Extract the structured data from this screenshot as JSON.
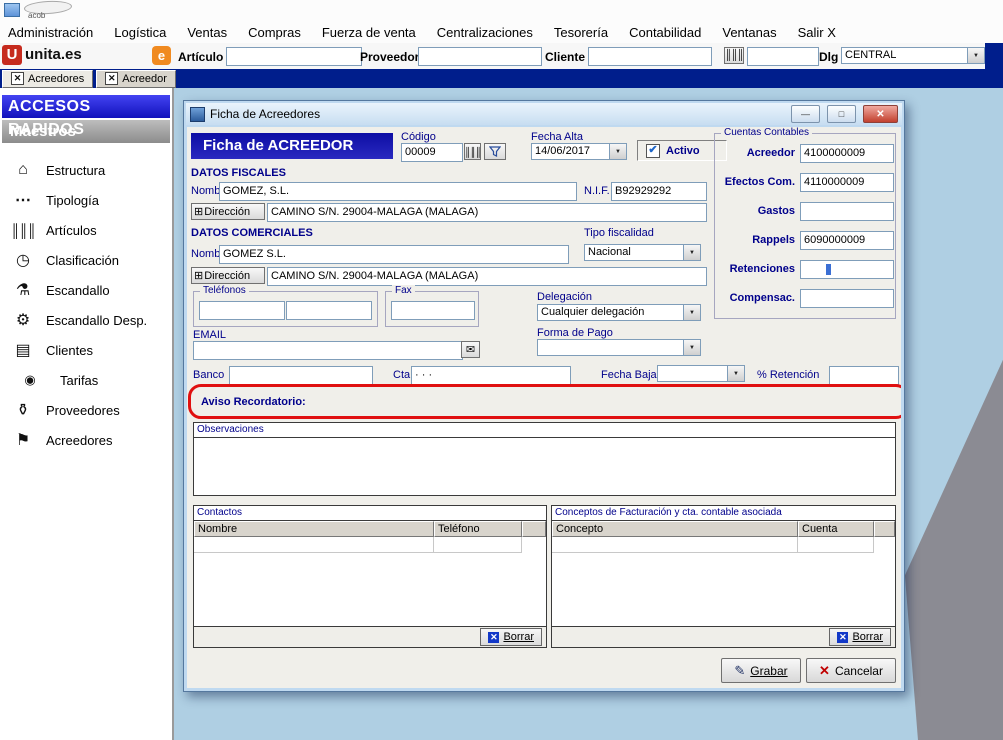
{
  "window": {
    "logo_text": "acob"
  },
  "menubar": {
    "items": [
      "Administración",
      "Logística",
      "Ventas",
      "Compras",
      "Fuerza de venta",
      "Centralizaciones",
      "Tesorería",
      "Contabilidad",
      "Ventanas",
      "Salir X"
    ]
  },
  "toolbar": {
    "brand_u": "U",
    "brand_name": "unita.es",
    "brand_e": "e",
    "articulo_label": "Artículo",
    "proveedor_label": "Proveedor",
    "cliente_label": "Cliente",
    "dlg_label": "Dlg",
    "dlg_value": "CENTRAL"
  },
  "tabs": [
    {
      "label": "Acreedores"
    },
    {
      "label": "Acreedor"
    }
  ],
  "sidebar": {
    "title": "ACCESOS RAPIDOS",
    "section": "Maestros",
    "items": [
      {
        "label": "Estructura",
        "icon": "⌂"
      },
      {
        "label": "Tipología",
        "icon": "⋯"
      },
      {
        "label": "Artículos",
        "icon": "║║║"
      },
      {
        "label": "Clasificación",
        "icon": "◷"
      },
      {
        "label": "Escandallo",
        "icon": "⚗"
      },
      {
        "label": "Escandallo Desp.",
        "icon": "⚙"
      },
      {
        "label": "Clientes",
        "icon": "▤"
      },
      {
        "label": "Tarifas",
        "icon": "◉"
      },
      {
        "label": "Proveedores",
        "icon": "⚱"
      },
      {
        "label": "Acreedores",
        "icon": "⚑"
      }
    ]
  },
  "dialog": {
    "title": "Ficha de Acreedores",
    "banner": "Ficha de ACREEDOR",
    "codigo": {
      "label": "Código",
      "value": "00009"
    },
    "fecha_alta": {
      "label": "Fecha Alta",
      "value": "14/06/2017"
    },
    "activo_label": "Activo",
    "cuentas": {
      "title": "Cuentas Contables",
      "rows": [
        {
          "label": "Acreedor",
          "value": "4100000009"
        },
        {
          "label": "Efectos Com.",
          "value": "4110000009"
        },
        {
          "label": "Gastos",
          "value": ""
        },
        {
          "label": "Rappels",
          "value": "6090000009"
        },
        {
          "label": "Retenciones",
          "value": ""
        },
        {
          "label": "Compensac.",
          "value": ""
        }
      ]
    },
    "fiscales": {
      "title": "DATOS FISCALES",
      "nombre_label": "Nombre",
      "nombre": "GOMEZ, S.L.",
      "nif_label": "N.I.F.",
      "nif": "B92929292",
      "direccion_label": "Dirección",
      "direccion": "CAMINO  S/N. 29004-MALAGA (MALAGA)"
    },
    "comerciales": {
      "title": "DATOS COMERCIALES",
      "nombre_label": "Nombre",
      "nombre": "GOMEZ  S.L.",
      "tipo_label": "Tipo fiscalidad",
      "tipo": "Nacional",
      "direccion_label": "Dirección",
      "direccion": "CAMINO  S/N. 29004-MALAGA (MALAGA)"
    },
    "telefonos_label": "Teléfonos",
    "fax_label": "Fax",
    "delegacion": {
      "label": "Delegación",
      "value": "Cualquier delegación"
    },
    "email_label": "EMAIL",
    "forma_pago": {
      "label": "Forma de Pago",
      "value": ""
    },
    "banco_label": "Banco",
    "cta_label": "Cta",
    "cta_value": "·      ·      ·",
    "fecha_baja_label": "Fecha Baja",
    "fecha_baja_value": "",
    "retencion_label": "% Retención",
    "retencion_value": "",
    "aviso_label": "Aviso Recordatorio:",
    "observaciones_label": "Observaciones",
    "contactos": {
      "title": "Contactos",
      "col1": "Nombre",
      "col2": "Teléfono",
      "borrar": "Borrar"
    },
    "conceptos": {
      "title": "Conceptos de Facturación y cta. contable asociada",
      "col1": "Concepto",
      "col2": "Cuenta",
      "borrar": "Borrar"
    },
    "grabar_label": "Grabar",
    "cancelar_label": "Cancelar"
  },
  "icons": {
    "arrow": "▼",
    "x": "✕",
    "check": "✔",
    "plus_box": "⊞",
    "barcode": "║║║",
    "mail": "✉",
    "pencil": "✎",
    "min": "—",
    "max": "□",
    "close": "✕"
  },
  "colors": {
    "accent_navy": "#00008B",
    "banner_blue": "#0D0DA4",
    "annotation_red": "#E01010",
    "mdi_blue": "#AFCFE3",
    "brand_red": "#C62B1E",
    "brand_orange": "#F08A20",
    "sidebar_blue": "#2424D8",
    "tabbar_navy": "#001E8C"
  }
}
